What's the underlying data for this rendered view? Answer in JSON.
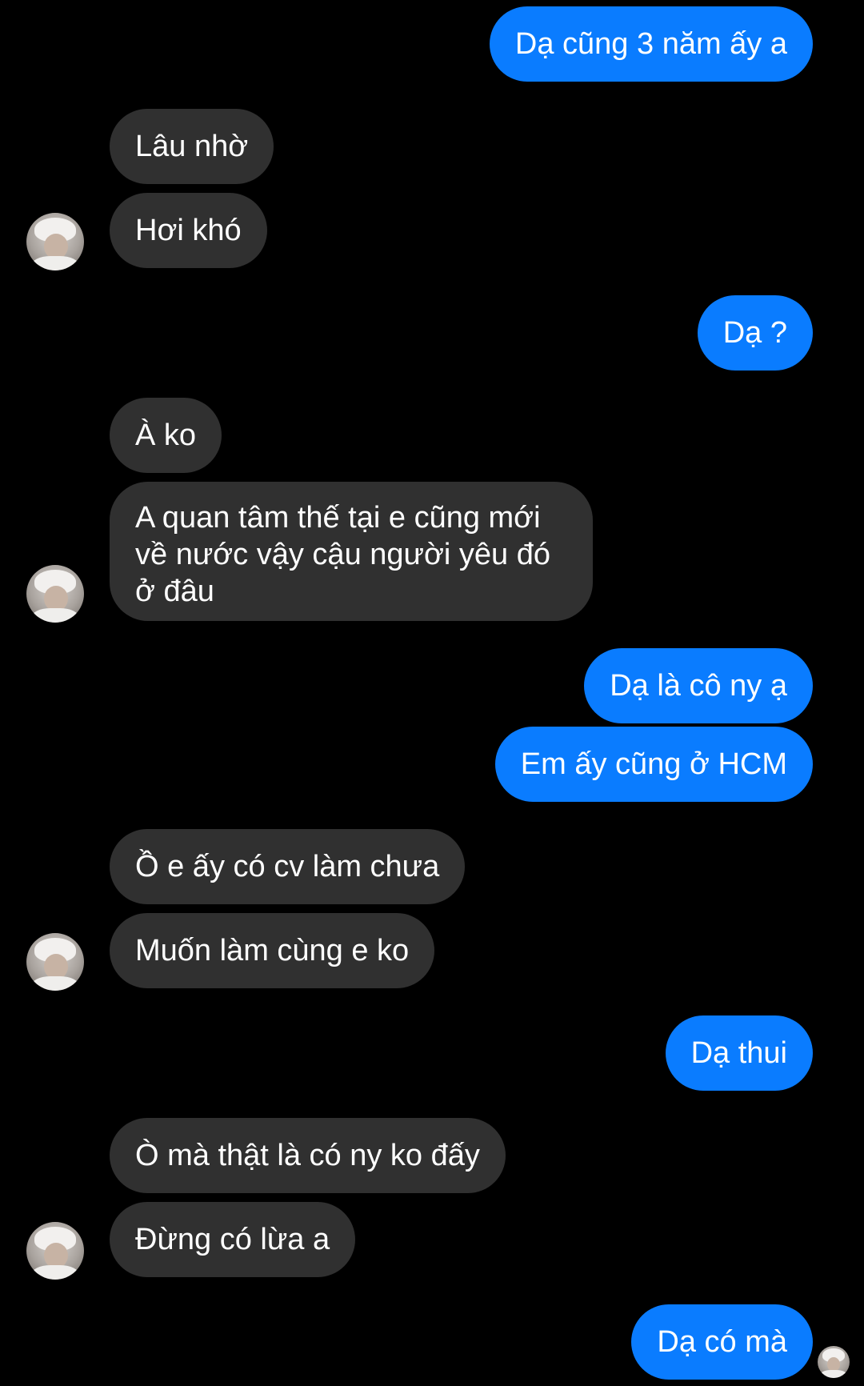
{
  "conversation": {
    "messages": [
      {
        "sender": "me",
        "text": "Dạ cũng 3 năm ấy a"
      },
      {
        "sender": "them",
        "text": "Lâu nhờ"
      },
      {
        "sender": "them",
        "text": "Hơi khó"
      },
      {
        "sender": "me",
        "text": "Dạ ?"
      },
      {
        "sender": "them",
        "text": "À ko"
      },
      {
        "sender": "them",
        "text": "A quan tâm thế tại e cũng mới về nước vậy cậu người yêu đó ở đâu"
      },
      {
        "sender": "me",
        "text": "Dạ là cô ny ạ"
      },
      {
        "sender": "me",
        "text": "Em ấy cũng ở HCM"
      },
      {
        "sender": "them",
        "text": "Ồ e ấy có cv làm chưa"
      },
      {
        "sender": "them",
        "text": "Muốn làm cùng e ko"
      },
      {
        "sender": "me",
        "text": "Dạ thui"
      },
      {
        "sender": "them",
        "text": "Ò mà thật là có ny ko đấy"
      },
      {
        "sender": "them",
        "text": "Đừng có lừa a"
      },
      {
        "sender": "me",
        "text": "Dạ có mà"
      }
    ]
  },
  "colors": {
    "background": "#000000",
    "outgoing_bubble": "#0a7cff",
    "incoming_bubble": "#303030",
    "text": "#ffffff"
  },
  "icons": {
    "contact_avatar": "contact-avatar-photo",
    "seen_indicator": "seen-avatar-photo"
  }
}
